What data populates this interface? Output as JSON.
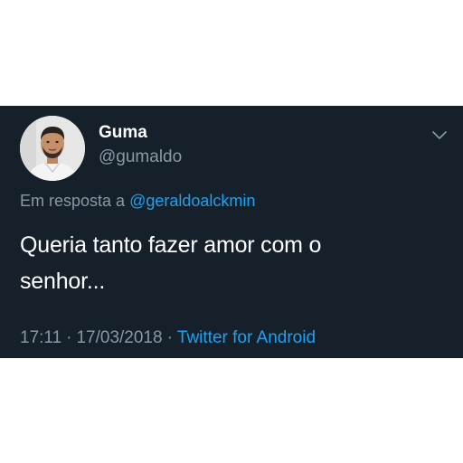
{
  "tweet": {
    "author": {
      "display_name": "Guma",
      "handle": "@gumaldo",
      "avatar": "profile-photo"
    },
    "reply": {
      "prefix": "Em resposta a",
      "to_handle": "@geraldoalckmin"
    },
    "text_line_1": "Queria tanto fazer amor com o",
    "text_line_2": "senhor...",
    "time": "17:11",
    "separator": "·",
    "date": "17/03/2018",
    "source": "Twitter for Android",
    "menu_icon": "chevron-down-icon"
  },
  "colors": {
    "background": "#15202b",
    "primary_text": "#ffffff",
    "secondary_text": "#8899a6",
    "link": "#1da1f2"
  }
}
